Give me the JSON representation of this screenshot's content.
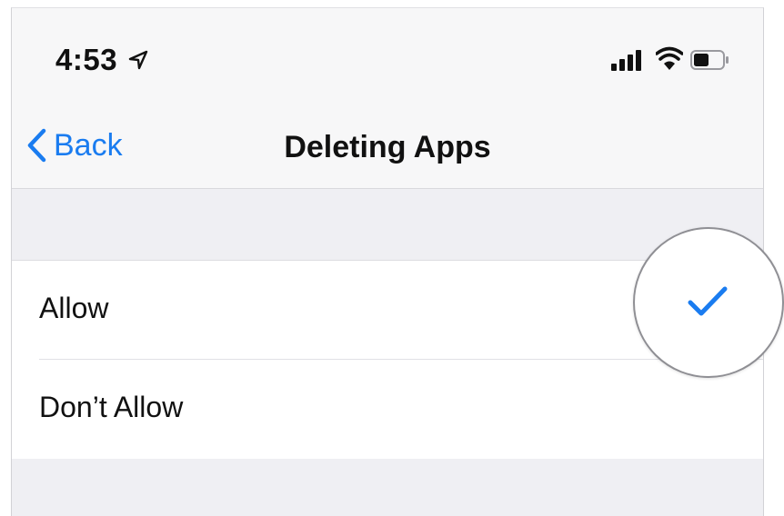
{
  "status_bar": {
    "time": "4:53",
    "icons": [
      "location-arrow-icon",
      "signal-bars-icon",
      "wifi-icon",
      "battery-icon"
    ]
  },
  "nav": {
    "back_label": "Back",
    "title": "Deleting Apps"
  },
  "options": [
    {
      "label": "Allow",
      "selected": true
    },
    {
      "label": "Don’t Allow",
      "selected": false
    }
  ],
  "colors": {
    "accent": "#1a7cf0",
    "group_background": "#efeff3",
    "separator": "#e1e1e5"
  }
}
